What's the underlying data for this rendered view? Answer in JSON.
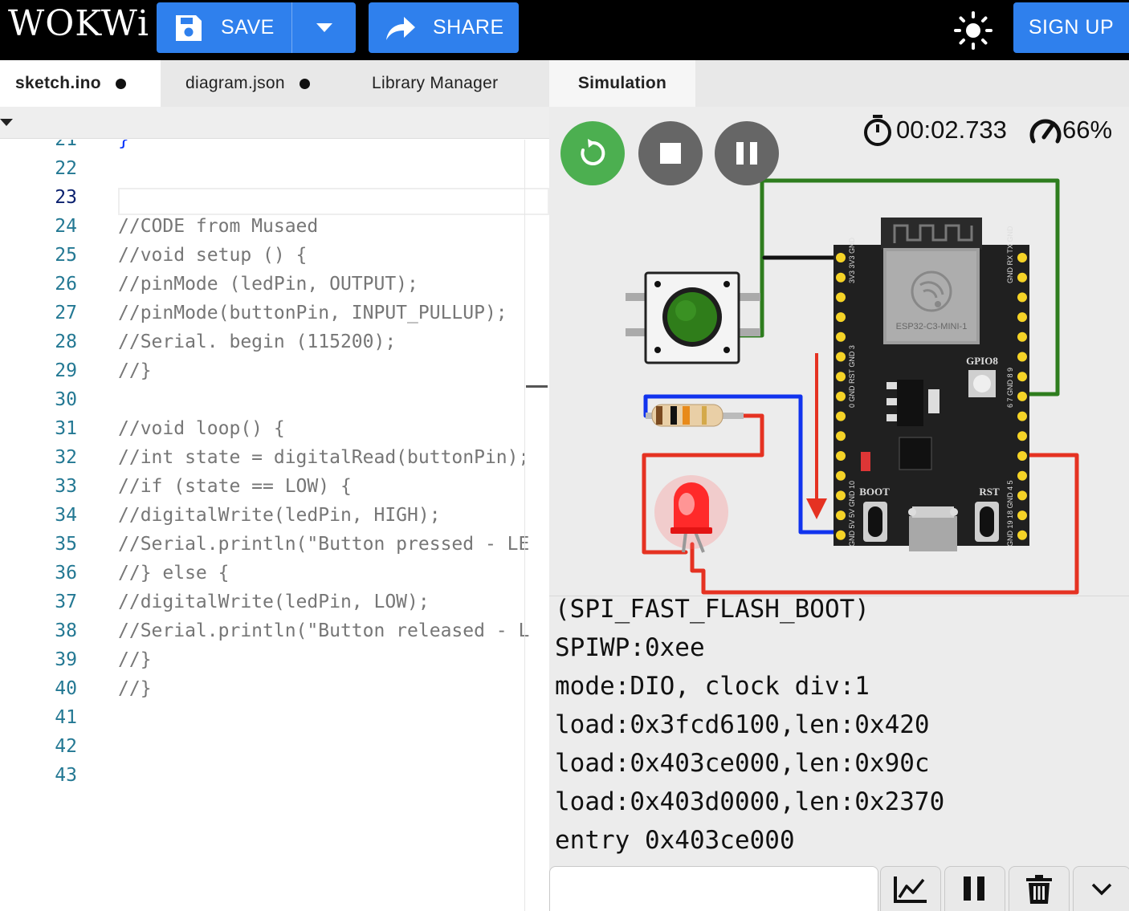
{
  "app": {
    "logo": "WOKWi"
  },
  "toolbar": {
    "save_label": "SAVE",
    "share_label": "SHARE",
    "signup_label": "SIGN UP"
  },
  "editor": {
    "tabs": [
      {
        "label": "sketch.ino",
        "unsaved": true,
        "active": true
      },
      {
        "label": "diagram.json",
        "unsaved": true,
        "active": false
      },
      {
        "label": "Library Manager",
        "unsaved": false,
        "active": false
      }
    ],
    "current_line": "23",
    "lines": [
      {
        "num": "21",
        "text": "}"
      },
      {
        "num": "22",
        "text": ""
      },
      {
        "num": "23",
        "text": ""
      },
      {
        "num": "24",
        "text": "//CODE from Musaed"
      },
      {
        "num": "25",
        "text": "//void setup () {"
      },
      {
        "num": "26",
        "text": "//pinMode (ledPin, OUTPUT);"
      },
      {
        "num": "27",
        "text": "//pinMode(buttonPin, INPUT_PULLUP);"
      },
      {
        "num": "28",
        "text": "//Serial. begin (115200);"
      },
      {
        "num": "29",
        "text": "//}"
      },
      {
        "num": "30",
        "text": ""
      },
      {
        "num": "31",
        "text": "//void loop() {"
      },
      {
        "num": "32",
        "text": "//int state = digitalRead(buttonPin);"
      },
      {
        "num": "33",
        "text": "//if (state == LOW) {"
      },
      {
        "num": "34",
        "text": "//digitalWrite(ledPin, HIGH);"
      },
      {
        "num": "35",
        "text": "//Serial.println(\"Button pressed - LE"
      },
      {
        "num": "36",
        "text": "//} else {"
      },
      {
        "num": "37",
        "text": "//digitalWrite(ledPin, LOW);"
      },
      {
        "num": "38",
        "text": "//Serial.println(\"Button released - L"
      },
      {
        "num": "39",
        "text": "//}"
      },
      {
        "num": "40",
        "text": "//}"
      },
      {
        "num": "41",
        "text": ""
      },
      {
        "num": "42",
        "text": ""
      },
      {
        "num": "43",
        "text": ""
      }
    ]
  },
  "simulation": {
    "tab_label": "Simulation",
    "timer": "00:02.733",
    "speed": "66%",
    "board": {
      "module_label": "ESP32-C3-MINI-1",
      "gpio_label": "GPIO8",
      "boot_label": "BOOT",
      "rst_label": "RST",
      "left_pins": "GND 5V 5V GND 10 GND RST GND 3V3 3V3 GND",
      "left_pins_lower": "0 1 2 3",
      "right_pins": "GND TX RX GND 9 8 GND 7 6 5 4 GND 18 19 GND"
    },
    "wire_colors": {
      "green": "#2e7d1e",
      "red": "#e53222",
      "blue": "#1133ee",
      "black": "#111111"
    },
    "led_color": "#ff2a2a",
    "button_color": "#2f7d1a"
  },
  "serial": {
    "lines": [
      "(SPI_FAST_FLASH_BOOT)",
      "SPIWP:0xee",
      "mode:DIO, clock div:1",
      "load:0x3fcd6100,len:0x420",
      "load:0x403ce000,len:0x90c",
      "load:0x403d0000,len:0x2370",
      "entry 0x403ce000"
    ],
    "input_value": ""
  },
  "icons": {
    "save": "floppy-disk-icon",
    "share": "share-arrow-icon",
    "theme": "sun-icon",
    "timer": "stopwatch-icon",
    "speed": "speedometer-icon",
    "restart": "restart-icon",
    "stop": "stop-icon",
    "pause": "pause-icon",
    "plotter": "chart-icon",
    "clear": "trash-icon",
    "collapse": "chevron-down-icon"
  }
}
